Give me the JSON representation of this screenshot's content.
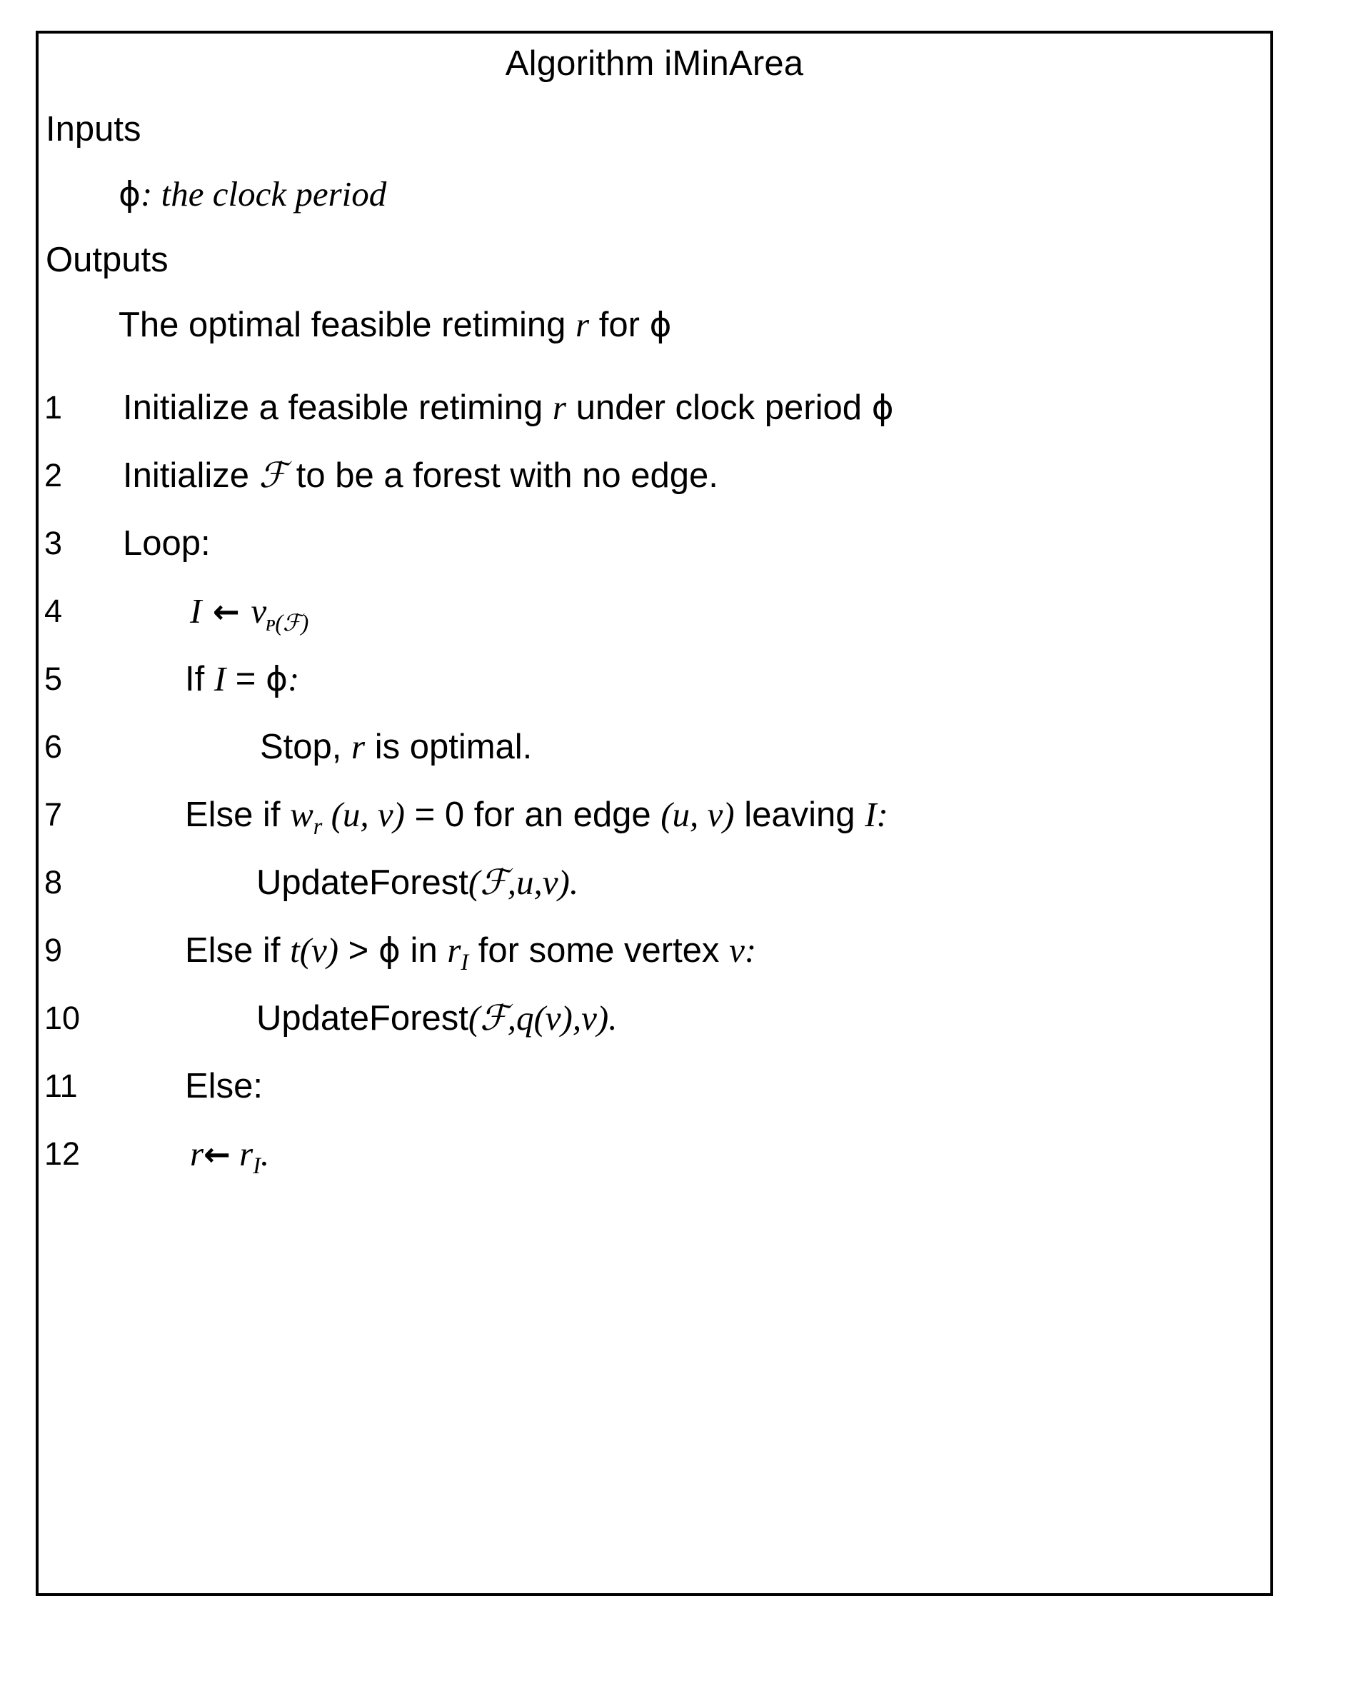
{
  "algorithm": {
    "title": "Algorithm iMinArea",
    "inputs_heading": "Inputs",
    "inputs_body_phi": "ϕ",
    "inputs_body_text": ": the clock period",
    "outputs_heading": "Outputs",
    "outputs_body_prefix": "The optimal feasible retiming ",
    "outputs_body_r": "r",
    "outputs_body_mid": " for ",
    "outputs_body_phi": "ϕ",
    "steps": [
      {
        "num": "1",
        "indent": "ind0",
        "parts": [
          {
            "t": "Initialize a feasible retiming ",
            "s": "plain"
          },
          {
            "t": "r",
            "s": "math"
          },
          {
            "t": " under clock period ",
            "s": "plain"
          },
          {
            "t": "ϕ",
            "s": "phi"
          }
        ]
      },
      {
        "num": "2",
        "indent": "ind0",
        "parts": [
          {
            "t": "Initialize ",
            "s": "plain"
          },
          {
            "t": "ℱ",
            "s": "cal"
          },
          {
            "t": " to be a forest with no edge.",
            "s": "plain"
          }
        ]
      },
      {
        "num": "3",
        "indent": "ind0",
        "parts": [
          {
            "t": "Loop:",
            "s": "plain"
          }
        ]
      },
      {
        "num": "4",
        "indent": "ind1b",
        "parts": [
          {
            "t": "I",
            "s": "math"
          },
          {
            "t": " ← ",
            "s": "arrow"
          },
          {
            "t": "ᴠ",
            "s": "calV"
          },
          {
            "t": "ᴘ(ℱ)",
            "s": "calsub"
          }
        ]
      },
      {
        "num": "5",
        "indent": "ind1",
        "parts": [
          {
            "t": "If ",
            "s": "plain"
          },
          {
            "t": "I",
            "s": "math"
          },
          {
            "t": " = ",
            "s": "plain"
          },
          {
            "t": "ϕ",
            "s": "phi"
          },
          {
            "t": ":",
            "s": "math"
          }
        ]
      },
      {
        "num": "6",
        "indent": "ind2",
        "parts": [
          {
            "t": "Stop, ",
            "s": "plain"
          },
          {
            "t": "r",
            "s": "math"
          },
          {
            "t": " is optimal.",
            "s": "plain"
          }
        ]
      },
      {
        "num": "7",
        "indent": "ind1",
        "parts": [
          {
            "t": "Else if  ",
            "s": "plain"
          },
          {
            "t": "w",
            "s": "math"
          },
          {
            "t": "r",
            "s": "sub"
          },
          {
            "t": " (u, v)",
            "s": "math"
          },
          {
            "t": " = 0 for an edge ",
            "s": "plain"
          },
          {
            "t": "(u, v)",
            "s": "math"
          },
          {
            "t": " leaving ",
            "s": "plain"
          },
          {
            "t": "I",
            "s": "math"
          },
          {
            "t": ":",
            "s": "math"
          }
        ]
      },
      {
        "num": "8",
        "indent": "ind3",
        "parts": [
          {
            "t": "UpdateForest",
            "s": "plain"
          },
          {
            "t": "(",
            "s": "math"
          },
          {
            "t": "ℱ",
            "s": "cal"
          },
          {
            "t": ",u,v)",
            "s": "math"
          },
          {
            "t": ".",
            "s": "math"
          }
        ]
      },
      {
        "num": "9",
        "indent": "ind1",
        "parts": [
          {
            "t": "Else if ",
            "s": "plain"
          },
          {
            "t": "t(v)",
            "s": "math"
          },
          {
            "t": " > ",
            "s": "plain"
          },
          {
            "t": "ϕ",
            "s": "phi"
          },
          {
            "t": " in ",
            "s": "plain"
          },
          {
            "t": "r",
            "s": "math"
          },
          {
            "t": "I",
            "s": "sub"
          },
          {
            "t": " for some vertex ",
            "s": "plain"
          },
          {
            "t": "v",
            "s": "math"
          },
          {
            "t": ":",
            "s": "math"
          }
        ]
      },
      {
        "num": "10",
        "indent": "ind3",
        "parts": [
          {
            "t": "UpdateForest",
            "s": "plain"
          },
          {
            "t": "(",
            "s": "math"
          },
          {
            "t": "ℱ",
            "s": "cal"
          },
          {
            "t": ",q(v),v)",
            "s": "math"
          },
          {
            "t": ".",
            "s": "math"
          }
        ]
      },
      {
        "num": "11",
        "indent": "ind1",
        "parts": [
          {
            "t": "Else:",
            "s": "plain"
          }
        ]
      },
      {
        "num": "12",
        "indent": "ind1b",
        "parts": [
          {
            "t": "r",
            "s": "math"
          },
          {
            "t": "←",
            "s": "arrow"
          },
          {
            "t": " r",
            "s": "math"
          },
          {
            "t": "I",
            "s": "sub"
          },
          {
            "t": ".",
            "s": "math"
          }
        ]
      }
    ]
  },
  "colors": {
    "ink": "#000000",
    "page": "#ffffff"
  }
}
